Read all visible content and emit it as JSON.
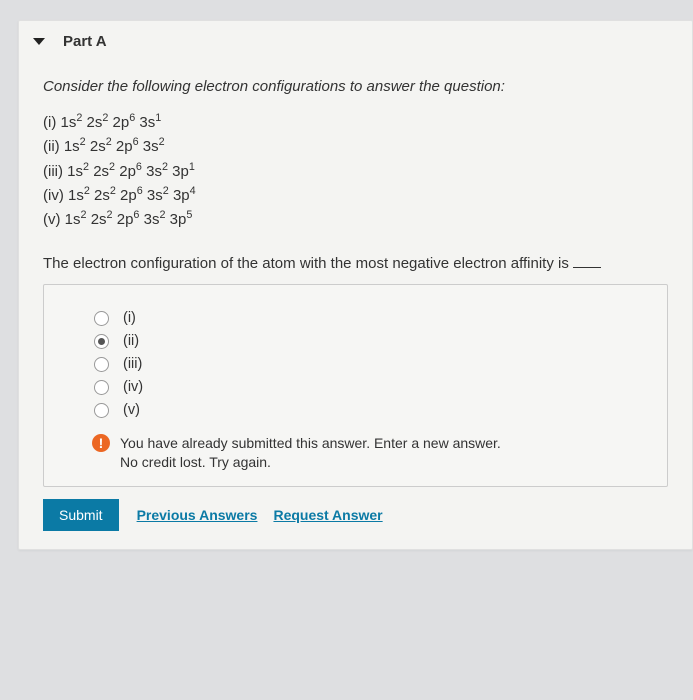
{
  "part_label": "Part A",
  "prompt": "Consider the following electron configurations to answer the question:",
  "configs": [
    {
      "roman": "(i)",
      "text": "1s² 2s² 2p⁶ 3s¹"
    },
    {
      "roman": "(ii)",
      "text": "1s² 2s² 2p⁶ 3s²"
    },
    {
      "roman": "(iii)",
      "text": "1s² 2s² 2p⁶ 3s² 3p¹"
    },
    {
      "roman": "(iv)",
      "text": "1s² 2s² 2p⁶ 3s² 3p⁴"
    },
    {
      "roman": "(v)",
      "text": "1s² 2s² 2p⁶ 3s² 3p⁵"
    }
  ],
  "question": "The electron configuration of the atom with the most negative electron affinity is",
  "options": [
    {
      "label": "(i)",
      "selected": false
    },
    {
      "label": "(ii)",
      "selected": true
    },
    {
      "label": "(iii)",
      "selected": false
    },
    {
      "label": "(iv)",
      "selected": false
    },
    {
      "label": "(v)",
      "selected": false
    }
  ],
  "feedback": {
    "icon": "!",
    "line1": "You have already submitted this answer. Enter a new answer.",
    "line2": "No credit lost. Try again."
  },
  "buttons": {
    "submit": "Submit",
    "previous": "Previous Answers",
    "request": "Request Answer"
  }
}
